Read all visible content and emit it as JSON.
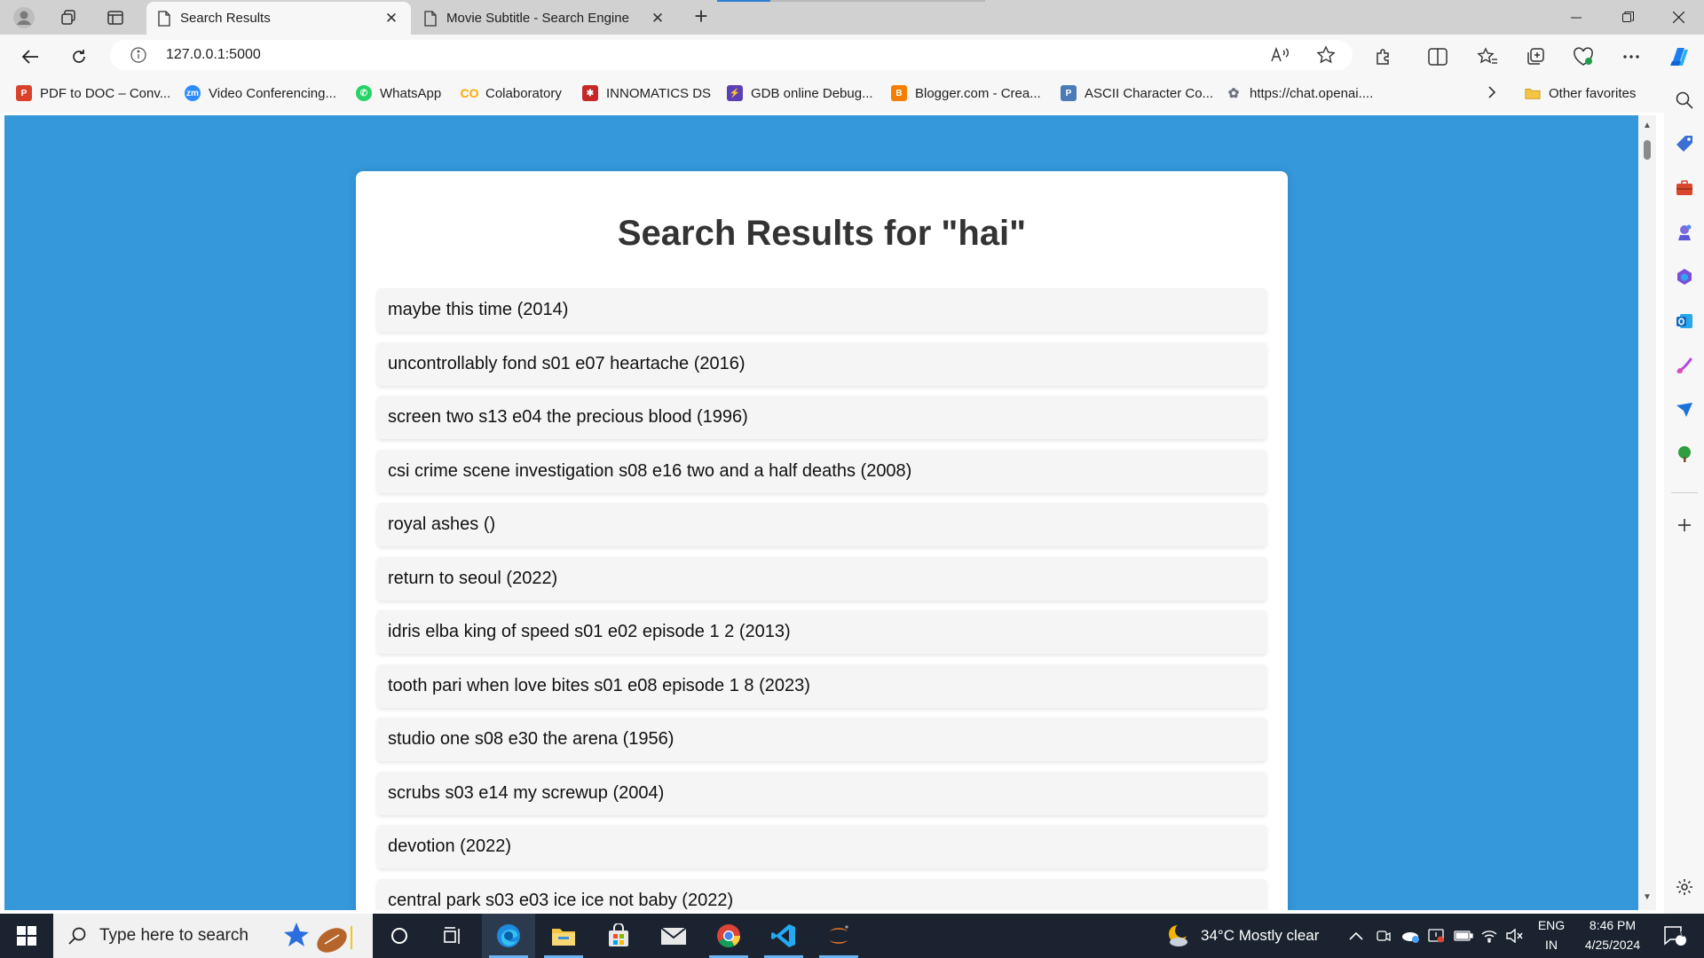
{
  "browser": {
    "tabs": [
      {
        "label": "Search Results",
        "active": true
      },
      {
        "label": "Movie Subtitle - Search Engine",
        "active": false
      }
    ],
    "address": "127.0.0.1:5000",
    "favorites": [
      {
        "label": "PDF to DOC – Conv...",
        "icon": "pdf-icon",
        "color": "#d9412b"
      },
      {
        "label": "Video Conferencing...",
        "icon": "zoom-icon",
        "color": "#2d8cff"
      },
      {
        "label": "WhatsApp",
        "icon": "whatsapp-icon",
        "color": "#25d366"
      },
      {
        "label": "Colaboratory",
        "icon": "colab-icon",
        "color": "#f9ab00"
      },
      {
        "label": "INNOMATICS DS",
        "icon": "innomatics-icon",
        "color": "#c62828"
      },
      {
        "label": "GDB online Debug...",
        "icon": "gdb-icon",
        "color": "#5b3fb6"
      },
      {
        "label": "Blogger.com - Crea...",
        "icon": "blogger-icon",
        "color": "#f57d00"
      },
      {
        "label": "ASCII Character Co...",
        "icon": "ascii-icon",
        "color": "#4a7bb7"
      },
      {
        "label": "https://chat.openai....",
        "icon": "openai-icon",
        "color": "#6b7280"
      }
    ],
    "other_favorites": "Other favorites"
  },
  "page": {
    "title": "Search Results for \"hai\"",
    "results": [
      "maybe this time (2014)",
      "uncontrollably fond s01 e07 heartache (2016)",
      "screen two s13 e04 the precious blood (1996)",
      "csi crime scene investigation s08 e16 two and a half deaths (2008)",
      "royal ashes ()",
      "return to seoul (2022)",
      "idris elba king of speed s01 e02 episode 1 2 (2013)",
      "tooth pari when love bites s01 e08 episode 1 8 (2023)",
      "studio one s08 e30 the arena (1956)",
      "scrubs s03 e14 my screwup (2004)",
      "devotion (2022)",
      "central park s03 e03 ice ice not baby (2022)"
    ]
  },
  "taskbar": {
    "search_placeholder": "Type here to search",
    "weather": "34°C  Mostly clear",
    "language": "ENG",
    "region": "IN",
    "time": "8:46 PM",
    "date": "4/25/2024",
    "notifications": "4"
  },
  "colors": {
    "page_background": "#3498db",
    "card_background": "#ffffff",
    "result_background": "#f5f5f5",
    "taskbar": "#1b2330"
  }
}
